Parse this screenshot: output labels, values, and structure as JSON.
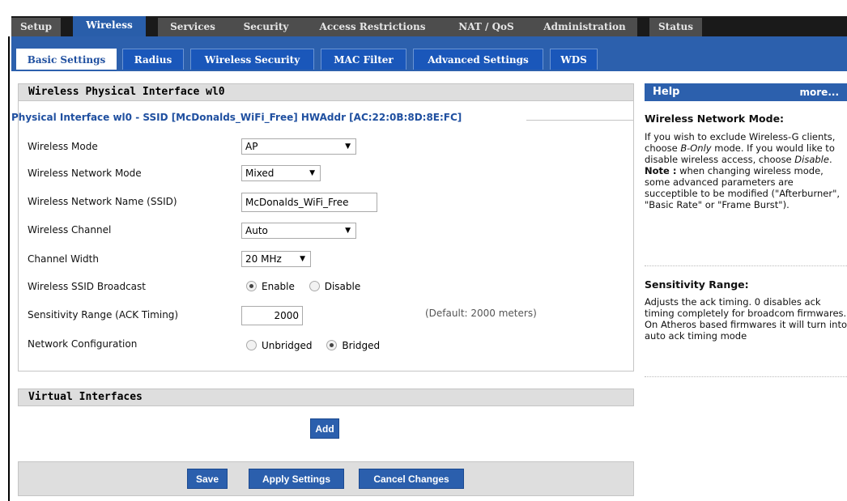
{
  "top_tabs": [
    "Setup",
    "Wireless",
    "Services",
    "Security",
    "Access Restrictions",
    "NAT / QoS",
    "Administration",
    "Status"
  ],
  "sub_tabs": [
    "Basic Settings",
    "Radius",
    "Wireless Security",
    "MAC Filter",
    "Advanced Settings",
    "WDS"
  ],
  "main": {
    "section_title": "Wireless Physical Interface wl0",
    "legend": "Physical Interface wl0 - SSID [McDonalds_WiFi_Free] HWAddr [AC:22:0B:8D:8E:FC]",
    "fields": {
      "wireless_mode": {
        "label": "Wireless Mode",
        "value": "AP"
      },
      "network_mode": {
        "label": "Wireless Network Mode",
        "value": "Mixed"
      },
      "ssid": {
        "label": "Wireless Network Name (SSID)",
        "value": "McDonalds_WiFi_Free"
      },
      "channel": {
        "label": "Wireless Channel",
        "value": "Auto"
      },
      "channel_width": {
        "label": "Channel Width",
        "value": "20 MHz"
      },
      "ssid_broadcast": {
        "label": "Wireless SSID Broadcast",
        "option_a": "Enable",
        "option_b": "Disable"
      },
      "sensitivity": {
        "label": "Sensitivity Range (ACK Timing)",
        "value": "2000",
        "hint": "(Default: 2000 meters)"
      },
      "net_config": {
        "label": "Network Configuration",
        "option_a": "Unbridged",
        "option_b": "Bridged"
      }
    },
    "virtual_title": "Virtual Interfaces",
    "add_label": "Add",
    "save_label": "Save",
    "apply_label": "Apply Settings",
    "cancel_label": "Cancel Changes"
  },
  "help": {
    "title": "Help",
    "more": "more...",
    "mode_title": "Wireless Network Mode:",
    "mode_text_1": "If you wish to exclude Wireless-G clients, choose ",
    "mode_text_b_only": "B-Only",
    "mode_text_2": " mode. If you would like to disable wireless access, choose ",
    "mode_text_disable": "Disable",
    "mode_text_3": ".",
    "note_label": "Note :",
    "note_text": " when changing wireless mode, some advanced parameters are succeptible to be modified (\"Afterburner\", \"Basic Rate\" or \"Frame Burst\").",
    "sens_title": "Sensitivity Range:",
    "sens_text": "Adjusts the ack timing. 0 disables ack timing completely for broadcom firmwares. On Atheros based firmwares it will turn into auto ack timing mode"
  },
  "colors": {
    "accent": "#2c60ad",
    "top_bar": "#1a1a1a",
    "tab": "#4d4d4d",
    "panel_head": "#dedede"
  }
}
